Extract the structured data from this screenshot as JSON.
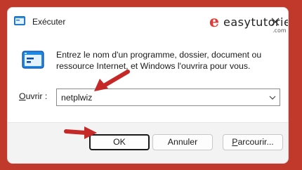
{
  "window": {
    "title": "Exécuter",
    "title_icon": "run-icon",
    "close_icon": "close-icon"
  },
  "watermark": {
    "logo_letter": "e",
    "text": "easytutoriel",
    "suffix": ".com"
  },
  "dialog": {
    "icon": "run-icon",
    "description": "Entrez le nom d'un programme, dossier, document ou ressource Internet, et Windows l'ouvrira pour vous.",
    "open_label_access": "O",
    "open_label_rest": "uvrir :",
    "open_value": "netplwiz"
  },
  "buttons": {
    "ok": "OK",
    "cancel": "Annuler",
    "browse_access": "P",
    "browse_rest": "arcourir..."
  },
  "colors": {
    "accent_red": "#d32f2f",
    "background": "#c0392b"
  }
}
